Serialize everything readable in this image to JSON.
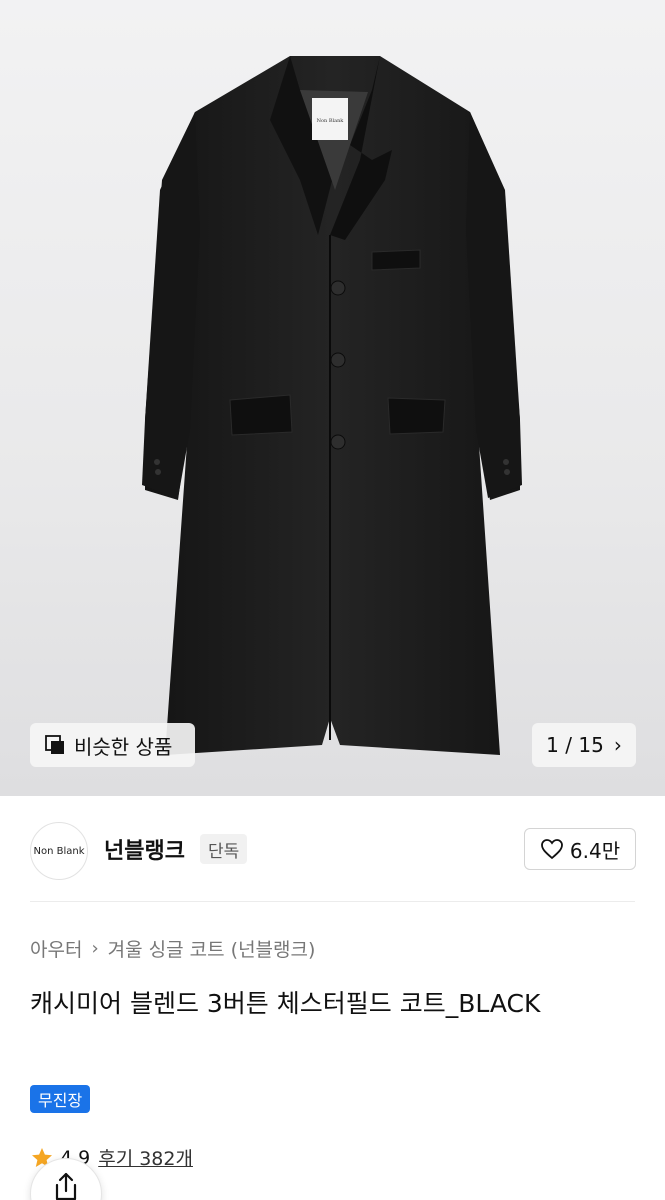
{
  "gallery": {
    "similar_label": "비슷한 상품",
    "counter": "1 / 15",
    "label_tag_text": "Non Blank"
  },
  "brand": {
    "logo_text": "Non Blank",
    "name": "넌블랭크",
    "badge": "단독",
    "likes": "6.4만"
  },
  "breadcrumb": {
    "category": "아우터",
    "subcategory": "겨울 싱글 코트 (넌블랭크)"
  },
  "product": {
    "title": "캐시미어 블렌드 3버튼 체스터필드 코트_BLACK",
    "tag": "무진장"
  },
  "rating": {
    "score": "4.9",
    "reviews": "후기 382개"
  },
  "colors": {
    "accent_blue": "#1a73e8",
    "star": "#f5a623",
    "coat": "#1c1c1c"
  }
}
